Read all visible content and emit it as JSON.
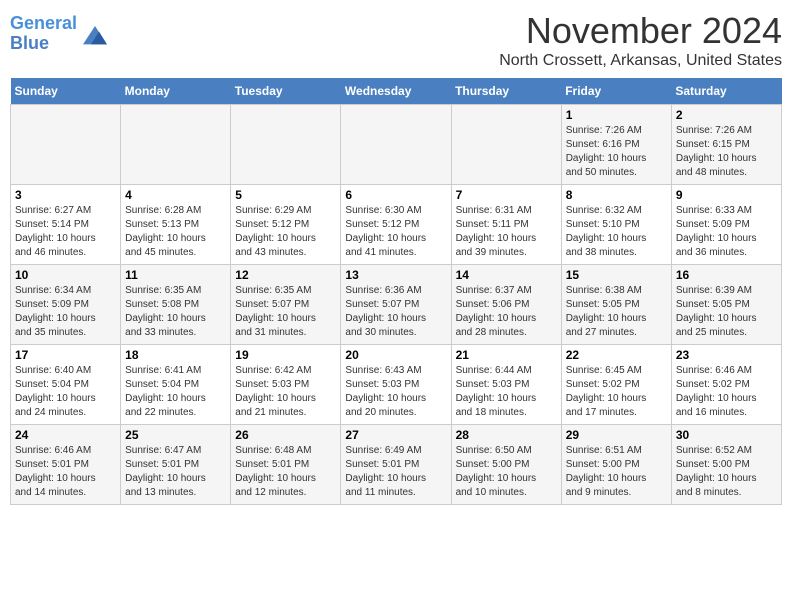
{
  "header": {
    "logo_line1": "General",
    "logo_line2": "Blue",
    "month": "November 2024",
    "location": "North Crossett, Arkansas, United States"
  },
  "weekdays": [
    "Sunday",
    "Monday",
    "Tuesday",
    "Wednesday",
    "Thursday",
    "Friday",
    "Saturday"
  ],
  "weeks": [
    [
      {
        "day": "",
        "info": ""
      },
      {
        "day": "",
        "info": ""
      },
      {
        "day": "",
        "info": ""
      },
      {
        "day": "",
        "info": ""
      },
      {
        "day": "",
        "info": ""
      },
      {
        "day": "1",
        "info": "Sunrise: 7:26 AM\nSunset: 6:16 PM\nDaylight: 10 hours\nand 50 minutes."
      },
      {
        "day": "2",
        "info": "Sunrise: 7:26 AM\nSunset: 6:15 PM\nDaylight: 10 hours\nand 48 minutes."
      }
    ],
    [
      {
        "day": "3",
        "info": "Sunrise: 6:27 AM\nSunset: 5:14 PM\nDaylight: 10 hours\nand 46 minutes."
      },
      {
        "day": "4",
        "info": "Sunrise: 6:28 AM\nSunset: 5:13 PM\nDaylight: 10 hours\nand 45 minutes."
      },
      {
        "day": "5",
        "info": "Sunrise: 6:29 AM\nSunset: 5:12 PM\nDaylight: 10 hours\nand 43 minutes."
      },
      {
        "day": "6",
        "info": "Sunrise: 6:30 AM\nSunset: 5:12 PM\nDaylight: 10 hours\nand 41 minutes."
      },
      {
        "day": "7",
        "info": "Sunrise: 6:31 AM\nSunset: 5:11 PM\nDaylight: 10 hours\nand 39 minutes."
      },
      {
        "day": "8",
        "info": "Sunrise: 6:32 AM\nSunset: 5:10 PM\nDaylight: 10 hours\nand 38 minutes."
      },
      {
        "day": "9",
        "info": "Sunrise: 6:33 AM\nSunset: 5:09 PM\nDaylight: 10 hours\nand 36 minutes."
      }
    ],
    [
      {
        "day": "10",
        "info": "Sunrise: 6:34 AM\nSunset: 5:09 PM\nDaylight: 10 hours\nand 35 minutes."
      },
      {
        "day": "11",
        "info": "Sunrise: 6:35 AM\nSunset: 5:08 PM\nDaylight: 10 hours\nand 33 minutes."
      },
      {
        "day": "12",
        "info": "Sunrise: 6:35 AM\nSunset: 5:07 PM\nDaylight: 10 hours\nand 31 minutes."
      },
      {
        "day": "13",
        "info": "Sunrise: 6:36 AM\nSunset: 5:07 PM\nDaylight: 10 hours\nand 30 minutes."
      },
      {
        "day": "14",
        "info": "Sunrise: 6:37 AM\nSunset: 5:06 PM\nDaylight: 10 hours\nand 28 minutes."
      },
      {
        "day": "15",
        "info": "Sunrise: 6:38 AM\nSunset: 5:05 PM\nDaylight: 10 hours\nand 27 minutes."
      },
      {
        "day": "16",
        "info": "Sunrise: 6:39 AM\nSunset: 5:05 PM\nDaylight: 10 hours\nand 25 minutes."
      }
    ],
    [
      {
        "day": "17",
        "info": "Sunrise: 6:40 AM\nSunset: 5:04 PM\nDaylight: 10 hours\nand 24 minutes."
      },
      {
        "day": "18",
        "info": "Sunrise: 6:41 AM\nSunset: 5:04 PM\nDaylight: 10 hours\nand 22 minutes."
      },
      {
        "day": "19",
        "info": "Sunrise: 6:42 AM\nSunset: 5:03 PM\nDaylight: 10 hours\nand 21 minutes."
      },
      {
        "day": "20",
        "info": "Sunrise: 6:43 AM\nSunset: 5:03 PM\nDaylight: 10 hours\nand 20 minutes."
      },
      {
        "day": "21",
        "info": "Sunrise: 6:44 AM\nSunset: 5:03 PM\nDaylight: 10 hours\nand 18 minutes."
      },
      {
        "day": "22",
        "info": "Sunrise: 6:45 AM\nSunset: 5:02 PM\nDaylight: 10 hours\nand 17 minutes."
      },
      {
        "day": "23",
        "info": "Sunrise: 6:46 AM\nSunset: 5:02 PM\nDaylight: 10 hours\nand 16 minutes."
      }
    ],
    [
      {
        "day": "24",
        "info": "Sunrise: 6:46 AM\nSunset: 5:01 PM\nDaylight: 10 hours\nand 14 minutes."
      },
      {
        "day": "25",
        "info": "Sunrise: 6:47 AM\nSunset: 5:01 PM\nDaylight: 10 hours\nand 13 minutes."
      },
      {
        "day": "26",
        "info": "Sunrise: 6:48 AM\nSunset: 5:01 PM\nDaylight: 10 hours\nand 12 minutes."
      },
      {
        "day": "27",
        "info": "Sunrise: 6:49 AM\nSunset: 5:01 PM\nDaylight: 10 hours\nand 11 minutes."
      },
      {
        "day": "28",
        "info": "Sunrise: 6:50 AM\nSunset: 5:00 PM\nDaylight: 10 hours\nand 10 minutes."
      },
      {
        "day": "29",
        "info": "Sunrise: 6:51 AM\nSunset: 5:00 PM\nDaylight: 10 hours\nand 9 minutes."
      },
      {
        "day": "30",
        "info": "Sunrise: 6:52 AM\nSunset: 5:00 PM\nDaylight: 10 hours\nand 8 minutes."
      }
    ]
  ]
}
